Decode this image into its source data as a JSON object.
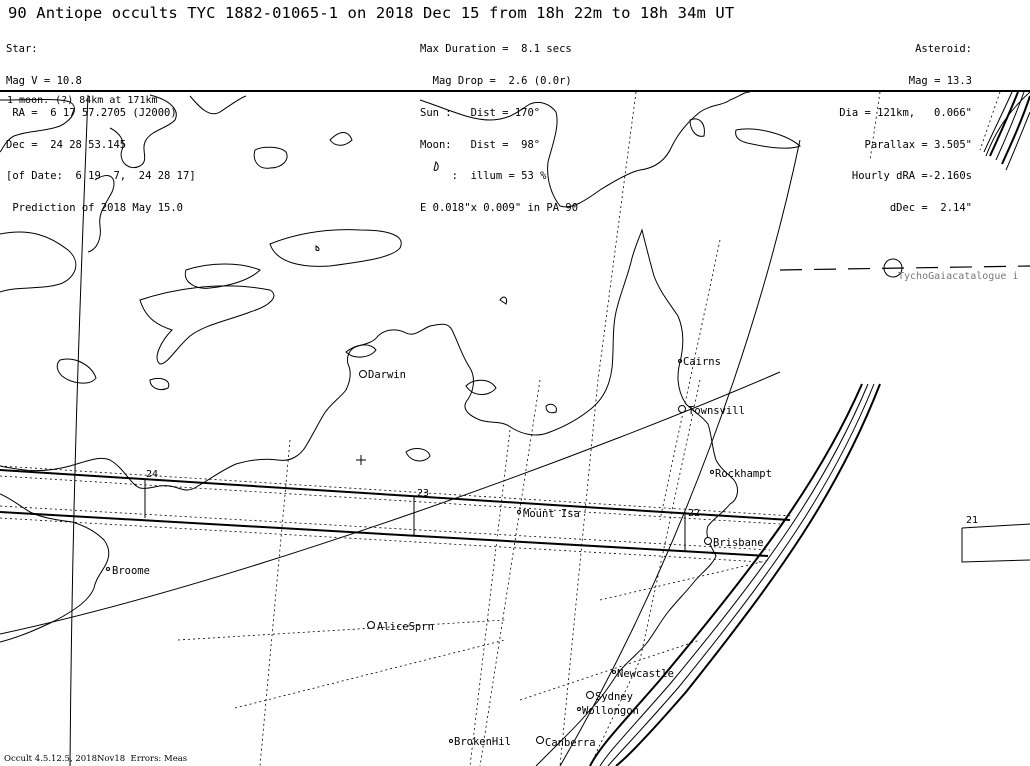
{
  "header": {
    "title": "90 Antiope occults TYC 1882-01065-1 on 2018 Dec 15 from 18h 22m to 18h 34m UT",
    "star": [
      "Star:",
      "Mag V = 10.8",
      " RA =  6 17 57.2705 (J2000)",
      "Dec =  24 28 53.145",
      "[of Date:  6 19  7,  24 28 17]",
      " Prediction of 2018 May 15.0"
    ],
    "event": [
      "Max Duration =  8.1 secs",
      "  Mag Drop =  2.6 (0.0r)",
      "Sun :   Dist = 170°",
      "Moon:   Dist =  98°",
      "     :  illum = 53 %",
      "E 0.018\"x 0.009\" in PA 90"
    ],
    "asteroid": [
      "Asteroid:",
      "Mag = 13.3",
      "Dia = 121km,   0.066\"",
      "Parallax = 3.505\"",
      "Hourly dRA =-2.160s",
      "dDec =  2.14\""
    ]
  },
  "moon_note": "1 moon. (?) 84km at 171km",
  "catalogue_note": "TychoGaiacatalogue i",
  "time_marks": [
    "24",
    "23",
    "22",
    "21"
  ],
  "cities": [
    {
      "name": "Darwin"
    },
    {
      "name": "Cairns"
    },
    {
      "name": "Townsvill"
    },
    {
      "name": "Rockhampt"
    },
    {
      "name": "Mount Isa"
    },
    {
      "name": "Brisbane"
    },
    {
      "name": "Broome"
    },
    {
      "name": "AliceSprn"
    },
    {
      "name": "Newcastle"
    },
    {
      "name": "Sydney"
    },
    {
      "name": "Wollongon"
    },
    {
      "name": "BrokenHil"
    },
    {
      "name": "Canberra"
    }
  ],
  "footer": "Occult 4.5.12.5, 2018Nov18  Errors: Meas"
}
